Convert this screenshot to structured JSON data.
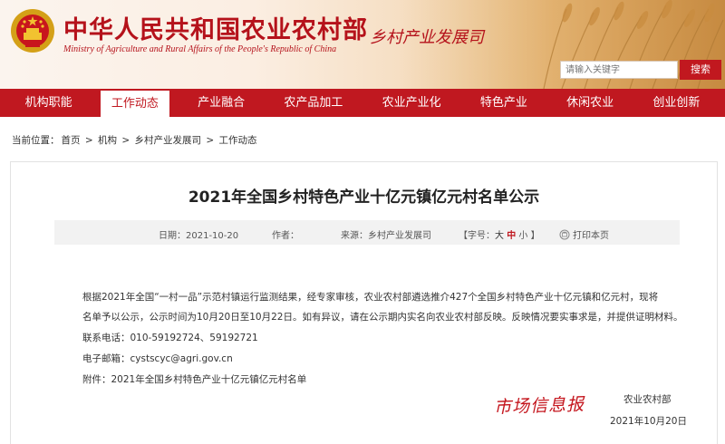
{
  "header": {
    "title_cn": "中华人民共和国农业农村部",
    "title_en": "Ministry of Agriculture and Rural Affairs of the People's Republic of China",
    "dept": "乡村产业发展司",
    "search_placeholder": "请输入关键字",
    "search_button": "搜索"
  },
  "nav": {
    "items": [
      "机构职能",
      "工作动态",
      "产业融合",
      "农产品加工",
      "农业产业化",
      "特色产业",
      "休闲农业",
      "创业创新"
    ],
    "active_index": 1
  },
  "breadcrumb": {
    "prefix": "当前位置：",
    "items": [
      "首页",
      "机构",
      "乡村产业发展司",
      "工作动态"
    ],
    "separator": ">"
  },
  "article": {
    "title": "2021年全国乡村特色产业十亿元镇亿元村名单公示",
    "meta": {
      "date_label": "日期：",
      "date": "2021-10-20",
      "author_label": "作者：",
      "author": "",
      "source_label": "来源：",
      "source": "乡村产业发展司",
      "fontsize_open": "【字号：",
      "fontsize_big": "大",
      "fontsize_mid": "中",
      "fontsize_small": "小",
      "fontsize_close": "】",
      "print_label": "打印本页"
    },
    "body_line1": "根据2021年全国“一村一品”示范村镇运行监测结果，经专家审核，农业农村部遴选推介427个全国乡村特色产业十亿元镇和亿元村，现将",
    "body_line2": "名单予以公示，公示时间为10月20日至10月22日。如有异议，请在公示期内实名向农业农村部反映。反映情况要实事求是，并提供证明材料。",
    "phone": "联系电话：010-59192724、59192721",
    "email": "电子邮箱：cystscyc@agri.gov.cn",
    "attachment": "附件：2021年全国乡村特色产业十亿元镇亿元村名单",
    "watermark": "市场信息报",
    "sign_org": "农业农村部",
    "sign_date": "2021年10月20日"
  },
  "colors": {
    "brand_red": "#c01820",
    "text": "#333333"
  }
}
